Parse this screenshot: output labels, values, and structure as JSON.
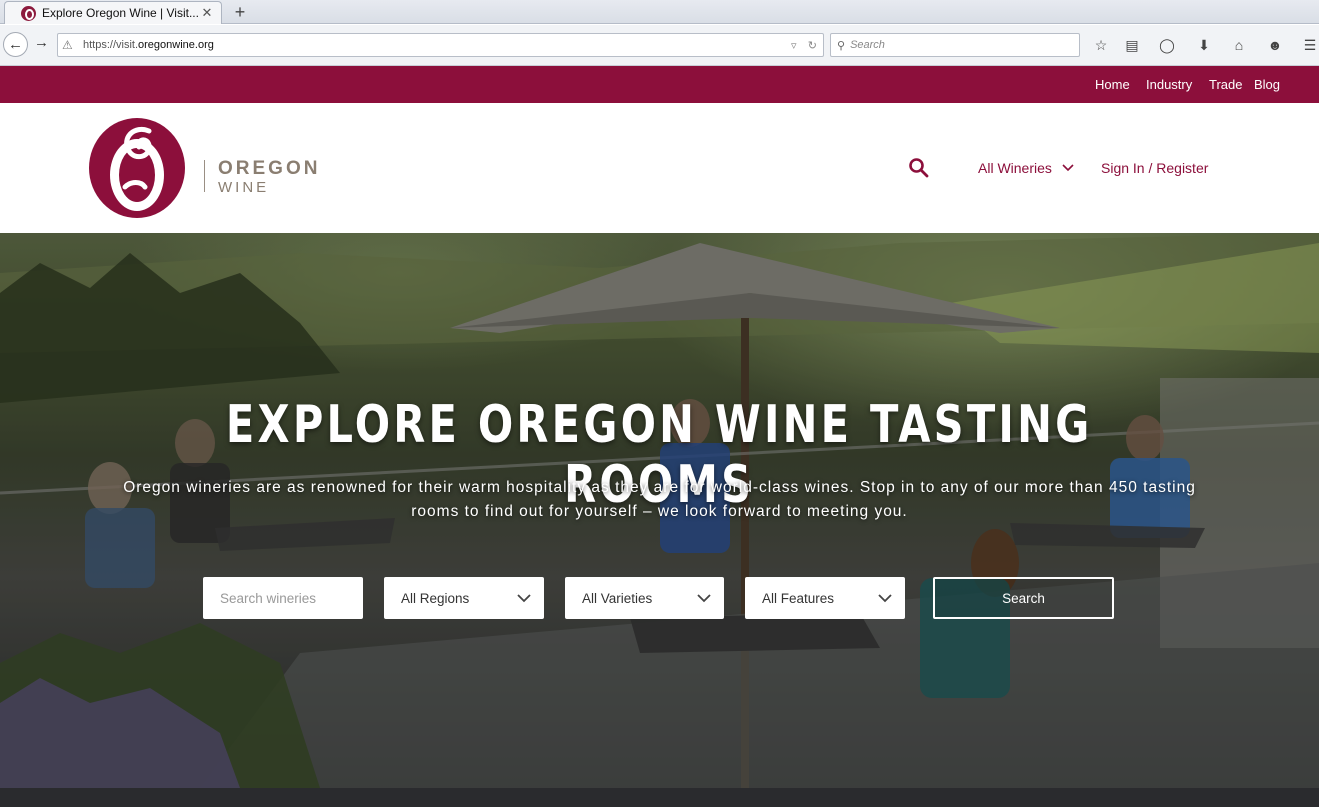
{
  "browser": {
    "tab_title": "Explore Oregon Wine | Visit...",
    "tab_close": "✕",
    "new_tab": "+",
    "url_prefix": "https://visit.",
    "url_domain": "oregonwine.org",
    "search_placeholder": "Search"
  },
  "topbar": {
    "background": "#8c0f3b",
    "links": [
      "Home",
      "Industry",
      "Trade",
      "Blog"
    ]
  },
  "header": {
    "logo_word1": "OREGON",
    "logo_word2": "WINE",
    "nav_wineries": "All Wineries",
    "nav_signin": "Sign In / Register",
    "accent": "#8c0f3b"
  },
  "hero": {
    "title": "EXPLORE OREGON WINE TASTING ROOMS",
    "subtitle": "Oregon wineries are as renowned for their warm hospitality as they are for world-class wines. Stop in to any of our more than 450 tasting rooms to find out for yourself – we look forward to meeting you.",
    "search_placeholder": "Search wineries",
    "region_select": "All Regions",
    "variety_select": "All Varieties",
    "feature_select": "All Features",
    "search_button": "Search"
  }
}
